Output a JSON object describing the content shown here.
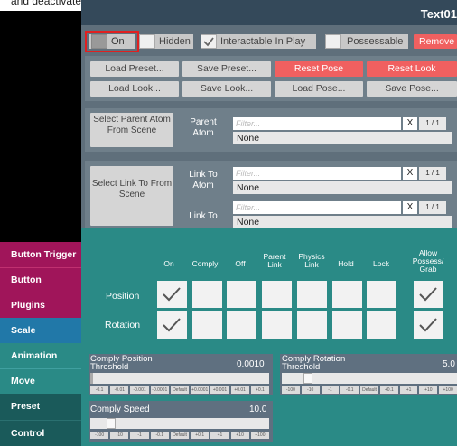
{
  "caption": "and deactivate On at the top, it will disappear now",
  "title": "Text01",
  "toggles": {
    "on": "On",
    "hidden": "Hidden",
    "interactable": "Interactable In Play",
    "possessable": "Possessable",
    "remove": "Remove"
  },
  "presets": {
    "load_preset": "Load Preset...",
    "save_preset": "Save Preset...",
    "reset_pose": "Reset Pose",
    "reset_look": "Reset Look",
    "load_look": "Load Look...",
    "save_look": "Save Look...",
    "load_pose": "Load Pose...",
    "save_pose": "Save Pose..."
  },
  "parent": {
    "select_button": "Select Parent Atom From Scene",
    "atom_label": "Parent Atom",
    "filter_placeholder": "Filter...",
    "x": "X",
    "page": "1 / 1",
    "value": "None"
  },
  "link": {
    "select_button": "Select Link To From Scene",
    "atom_label": "Link To Atom",
    "link_label": "Link To",
    "filter_placeholder": "Filter...",
    "x": "X",
    "page": "1 / 1",
    "atom_value": "None",
    "link_value": "None"
  },
  "grid": {
    "columns": [
      "On",
      "Comply",
      "Off",
      "Parent Link",
      "Physics Link",
      "Hold",
      "Lock",
      "Allow Possess/ Grab"
    ],
    "rows": [
      "Position",
      "Rotation"
    ],
    "checked": {
      "position": [
        true,
        false,
        false,
        false,
        false,
        false,
        false,
        true
      ],
      "rotation": [
        true,
        false,
        false,
        false,
        false,
        false,
        false,
        true
      ]
    }
  },
  "sliders": {
    "comply_position_label": "Comply Position Threshold",
    "comply_position_value": "0.0010",
    "comply_position_ticks": [
      "-0.1",
      "-0.01",
      "-0.001",
      "-0.0001",
      "Default",
      "+0.0001",
      "+0.001",
      "+0.01",
      "+0.1"
    ],
    "comply_rotation_label": "Comply Rotation Threshold",
    "comply_rotation_value": "5.0",
    "comply_rotation_ticks": [
      "-100",
      "-10",
      "-1",
      "-0.1",
      "Default",
      "+0.1",
      "+1",
      "+10",
      "+100"
    ],
    "comply_speed_label": "Comply Speed",
    "comply_speed_value": "10.0",
    "comply_speed_ticks": [
      "-100",
      "-10",
      "-1",
      "-0.1",
      "Default",
      "+0.1",
      "+1",
      "+10",
      "+100"
    ]
  },
  "sidebar": [
    {
      "label": "Button Trigger",
      "color": "#a0155a"
    },
    {
      "label": "Button",
      "color": "#a0155a"
    },
    {
      "label": "Plugins",
      "color": "#a0155a"
    },
    {
      "label": "Scale",
      "color": "#2178a8"
    },
    {
      "label": "Animation",
      "color": "#2a8a86"
    },
    {
      "label": "Move",
      "color": "#2a8a86"
    },
    {
      "label": "Preset",
      "color": "#1a5a5a"
    },
    {
      "label": "Control",
      "color": "#1a5a5a"
    }
  ],
  "highlight_color": "#e02020"
}
